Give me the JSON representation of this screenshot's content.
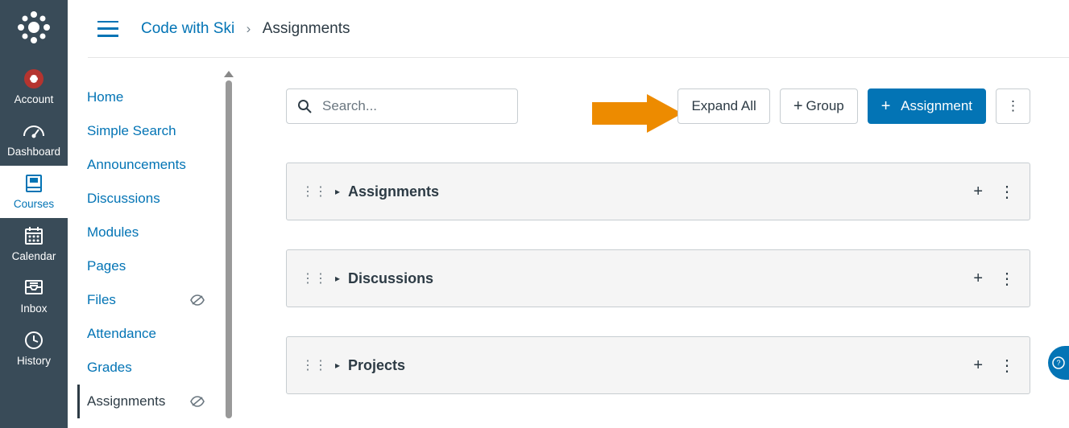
{
  "global_nav": {
    "items": [
      {
        "label": "Account"
      },
      {
        "label": "Dashboard"
      },
      {
        "label": "Courses"
      },
      {
        "label": "Calendar"
      },
      {
        "label": "Inbox"
      },
      {
        "label": "History"
      }
    ]
  },
  "breadcrumb": {
    "course": "Code with Ski",
    "sep": "›",
    "current": "Assignments"
  },
  "course_nav": {
    "items": [
      {
        "label": "Home"
      },
      {
        "label": "Simple Search"
      },
      {
        "label": "Announcements"
      },
      {
        "label": "Discussions"
      },
      {
        "label": "Modules"
      },
      {
        "label": "Pages"
      },
      {
        "label": "Files",
        "hidden": true
      },
      {
        "label": "Attendance"
      },
      {
        "label": "Grades"
      },
      {
        "label": "Assignments",
        "active": true,
        "hidden": true
      }
    ]
  },
  "toolbar": {
    "search_placeholder": "Search...",
    "expand_all": "Expand All",
    "group": "Group",
    "assignment": "Assignment"
  },
  "groups": [
    {
      "title": "Assignments"
    },
    {
      "title": "Discussions"
    },
    {
      "title": "Projects"
    }
  ]
}
